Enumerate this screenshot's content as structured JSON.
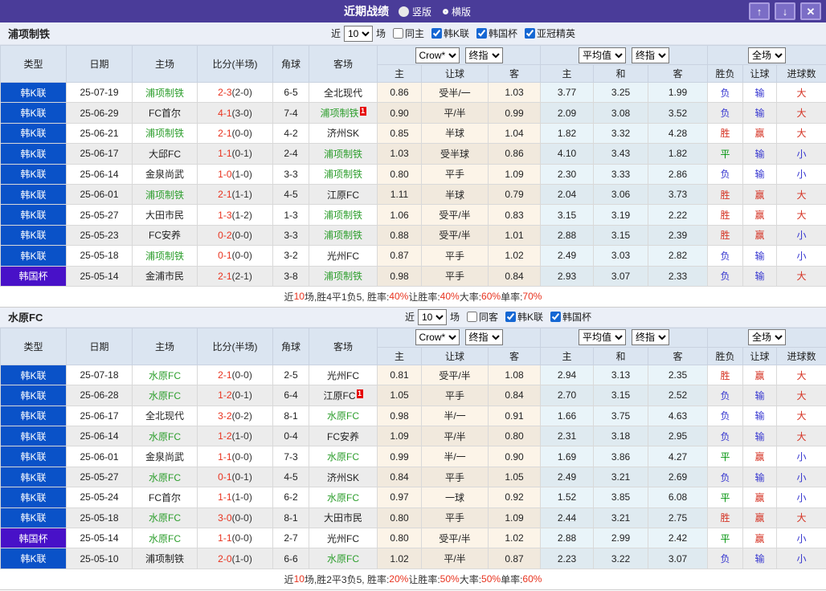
{
  "colors": {
    "titlebar_purple": "#4a3c99",
    "league_blue": "#0a52c8",
    "cup_purple": "#4811c8",
    "focus_team_green": "#2d9e2d",
    "score_red": "#e8321e",
    "result_red": "#d53223",
    "result_blue": "#3535cf",
    "result_green": "#00930c"
  },
  "titlebar": {
    "title": "近期战绩",
    "radios": [
      {
        "label": "竖版",
        "selected": true
      },
      {
        "label": "横版",
        "selected": false
      }
    ],
    "up_button": "↑",
    "down_button": "↓",
    "close_button": "✕"
  },
  "table_header": {
    "type": "类型",
    "date": "日期",
    "home": "主场",
    "score": "比分(半场)",
    "corner": "角球",
    "away": "客场",
    "crow_select": "Crow*",
    "final_select": "终指",
    "avg_select": "平均值",
    "final_select2": "终指",
    "full_select": "全场",
    "sub": {
      "h_home": "主",
      "h_line": "让球",
      "h_away": "客",
      "a_home": "主",
      "a_draw": "和",
      "a_away": "客",
      "r_wl": "胜负",
      "r_let": "让球",
      "r_goals": "进球数"
    }
  },
  "sections": [
    {
      "team": "浦项制铁",
      "filter": {
        "near_label": "近",
        "count": "10",
        "games_label": "场",
        "same_label": "同主",
        "same_checked": false,
        "leagues": [
          {
            "label": "韩K联",
            "checked": true
          },
          {
            "label": "韩国杯",
            "checked": true
          },
          {
            "label": "亚冠精英",
            "checked": true
          }
        ]
      },
      "rows": [
        {
          "type": "韩K联",
          "type_color": "blue",
          "date": "25-07-19",
          "home": "浦项制铁",
          "home_focus": true,
          "home_redcard": "",
          "score": "2-3",
          "half": "(2-0)",
          "corner": "6-5",
          "away": "全北现代",
          "away_focus": false,
          "away_redcard": "",
          "odds_home": "0.86",
          "line": "受半/一",
          "odds_away": "1.03",
          "avg_home": "3.77",
          "avg_draw": "3.25",
          "avg_away": "1.99",
          "res_wl": "负",
          "res_wl_c": "blue",
          "res_let": "输",
          "res_let_c": "blue",
          "res_goal": "大",
          "res_goal_c": "red"
        },
        {
          "type": "韩K联",
          "type_color": "blue",
          "date": "25-06-29",
          "home": "FC首尔",
          "home_focus": false,
          "home_redcard": "",
          "score": "4-1",
          "half": "(3-0)",
          "corner": "7-4",
          "away": "浦项制铁",
          "away_focus": true,
          "away_redcard": "1",
          "odds_home": "0.90",
          "line": "平/半",
          "odds_away": "0.99",
          "avg_home": "2.09",
          "avg_draw": "3.08",
          "avg_away": "3.52",
          "res_wl": "负",
          "res_wl_c": "blue",
          "res_let": "输",
          "res_let_c": "blue",
          "res_goal": "大",
          "res_goal_c": "red"
        },
        {
          "type": "韩K联",
          "type_color": "blue",
          "date": "25-06-21",
          "home": "浦项制铁",
          "home_focus": true,
          "home_redcard": "",
          "score": "2-1",
          "half": "(0-0)",
          "corner": "4-2",
          "away": "济州SK",
          "away_focus": false,
          "away_redcard": "",
          "odds_home": "0.85",
          "line": "半球",
          "odds_away": "1.04",
          "avg_home": "1.82",
          "avg_draw": "3.32",
          "avg_away": "4.28",
          "res_wl": "胜",
          "res_wl_c": "red",
          "res_let": "赢",
          "res_let_c": "red",
          "res_goal": "大",
          "res_goal_c": "red"
        },
        {
          "type": "韩K联",
          "type_color": "blue",
          "date": "25-06-17",
          "home": "大邱FC",
          "home_focus": false,
          "home_redcard": "",
          "score": "1-1",
          "half": "(0-1)",
          "corner": "2-4",
          "away": "浦项制铁",
          "away_focus": true,
          "away_redcard": "",
          "odds_home": "1.03",
          "line": "受半球",
          "odds_away": "0.86",
          "avg_home": "4.10",
          "avg_draw": "3.43",
          "avg_away": "1.82",
          "res_wl": "平",
          "res_wl_c": "green",
          "res_let": "输",
          "res_let_c": "blue",
          "res_goal": "小",
          "res_goal_c": "blue"
        },
        {
          "type": "韩K联",
          "type_color": "blue",
          "date": "25-06-14",
          "home": "金泉尚武",
          "home_focus": false,
          "home_redcard": "",
          "score": "1-0",
          "half": "(1-0)",
          "corner": "3-3",
          "away": "浦项制铁",
          "away_focus": true,
          "away_redcard": "",
          "odds_home": "0.80",
          "line": "平手",
          "odds_away": "1.09",
          "avg_home": "2.30",
          "avg_draw": "3.33",
          "avg_away": "2.86",
          "res_wl": "负",
          "res_wl_c": "blue",
          "res_let": "输",
          "res_let_c": "blue",
          "res_goal": "小",
          "res_goal_c": "blue"
        },
        {
          "type": "韩K联",
          "type_color": "blue",
          "date": "25-06-01",
          "home": "浦项制铁",
          "home_focus": true,
          "home_redcard": "",
          "score": "2-1",
          "half": "(1-1)",
          "corner": "4-5",
          "away": "江原FC",
          "away_focus": false,
          "away_redcard": "",
          "odds_home": "1.11",
          "line": "半球",
          "odds_away": "0.79",
          "avg_home": "2.04",
          "avg_draw": "3.06",
          "avg_away": "3.73",
          "res_wl": "胜",
          "res_wl_c": "red",
          "res_let": "赢",
          "res_let_c": "red",
          "res_goal": "大",
          "res_goal_c": "red"
        },
        {
          "type": "韩K联",
          "type_color": "blue",
          "date": "25-05-27",
          "home": "大田市民",
          "home_focus": false,
          "home_redcard": "",
          "score": "1-3",
          "half": "(1-2)",
          "corner": "1-3",
          "away": "浦项制铁",
          "away_focus": true,
          "away_redcard": "",
          "odds_home": "1.06",
          "line": "受平/半",
          "odds_away": "0.83",
          "avg_home": "3.15",
          "avg_draw": "3.19",
          "avg_away": "2.22",
          "res_wl": "胜",
          "res_wl_c": "red",
          "res_let": "赢",
          "res_let_c": "red",
          "res_goal": "大",
          "res_goal_c": "red"
        },
        {
          "type": "韩K联",
          "type_color": "blue",
          "date": "25-05-23",
          "home": "FC安养",
          "home_focus": false,
          "home_redcard": "",
          "score": "0-2",
          "half": "(0-0)",
          "corner": "3-3",
          "away": "浦项制铁",
          "away_focus": true,
          "away_redcard": "",
          "odds_home": "0.88",
          "line": "受平/半",
          "odds_away": "1.01",
          "avg_home": "2.88",
          "avg_draw": "3.15",
          "avg_away": "2.39",
          "res_wl": "胜",
          "res_wl_c": "red",
          "res_let": "赢",
          "res_let_c": "red",
          "res_goal": "小",
          "res_goal_c": "blue"
        },
        {
          "type": "韩K联",
          "type_color": "blue",
          "date": "25-05-18",
          "home": "浦项制铁",
          "home_focus": true,
          "home_redcard": "",
          "score": "0-1",
          "half": "(0-0)",
          "corner": "3-2",
          "away": "光州FC",
          "away_focus": false,
          "away_redcard": "",
          "odds_home": "0.87",
          "line": "平手",
          "odds_away": "1.02",
          "avg_home": "2.49",
          "avg_draw": "3.03",
          "avg_away": "2.82",
          "res_wl": "负",
          "res_wl_c": "blue",
          "res_let": "输",
          "res_let_c": "blue",
          "res_goal": "小",
          "res_goal_c": "blue"
        },
        {
          "type": "韩国杯",
          "type_color": "purple",
          "date": "25-05-14",
          "home": "金浦市民",
          "home_focus": false,
          "home_redcard": "",
          "score": "2-1",
          "half": "(2-1)",
          "corner": "3-8",
          "away": "浦项制铁",
          "away_focus": true,
          "away_redcard": "",
          "odds_home": "0.98",
          "line": "平手",
          "odds_away": "0.84",
          "avg_home": "2.93",
          "avg_draw": "3.07",
          "avg_away": "2.33",
          "res_wl": "负",
          "res_wl_c": "blue",
          "res_let": "输",
          "res_let_c": "blue",
          "res_goal": "大",
          "res_goal_c": "red"
        }
      ],
      "summary": [
        {
          "text": "近",
          "red": false
        },
        {
          "text": "10",
          "red": true
        },
        {
          "text": "场,胜4平1负5, 胜率:",
          "red": false
        },
        {
          "text": "40%",
          "red": true
        },
        {
          "text": " 让胜率:",
          "red": false
        },
        {
          "text": "40%",
          "red": true
        },
        {
          "text": " 大率:",
          "red": false
        },
        {
          "text": "60%",
          "red": true
        },
        {
          "text": " 单率:",
          "red": false
        },
        {
          "text": "70%",
          "red": true
        }
      ]
    },
    {
      "team": "水原FC",
      "filter": {
        "near_label": "近",
        "count": "10",
        "games_label": "场",
        "same_label": "同客",
        "same_checked": false,
        "leagues": [
          {
            "label": "韩K联",
            "checked": true
          },
          {
            "label": "韩国杯",
            "checked": true
          }
        ]
      },
      "rows": [
        {
          "type": "韩K联",
          "type_color": "blue",
          "date": "25-07-18",
          "home": "水原FC",
          "home_focus": true,
          "home_redcard": "",
          "score": "2-1",
          "half": "(0-0)",
          "corner": "2-5",
          "away": "光州FC",
          "away_focus": false,
          "away_redcard": "",
          "odds_home": "0.81",
          "line": "受平/半",
          "odds_away": "1.08",
          "avg_home": "2.94",
          "avg_draw": "3.13",
          "avg_away": "2.35",
          "res_wl": "胜",
          "res_wl_c": "red",
          "res_let": "赢",
          "res_let_c": "red",
          "res_goal": "大",
          "res_goal_c": "red"
        },
        {
          "type": "韩K联",
          "type_color": "blue",
          "date": "25-06-28",
          "home": "水原FC",
          "home_focus": true,
          "home_redcard": "",
          "score": "1-2",
          "half": "(0-1)",
          "corner": "6-4",
          "away": "江原FC",
          "away_focus": false,
          "away_redcard": "1",
          "odds_home": "1.05",
          "line": "平手",
          "odds_away": "0.84",
          "avg_home": "2.70",
          "avg_draw": "3.15",
          "avg_away": "2.52",
          "res_wl": "负",
          "res_wl_c": "blue",
          "res_let": "输",
          "res_let_c": "blue",
          "res_goal": "大",
          "res_goal_c": "red"
        },
        {
          "type": "韩K联",
          "type_color": "blue",
          "date": "25-06-17",
          "home": "全北现代",
          "home_focus": false,
          "home_redcard": "",
          "score": "3-2",
          "half": "(0-2)",
          "corner": "8-1",
          "away": "水原FC",
          "away_focus": true,
          "away_redcard": "",
          "odds_home": "0.98",
          "line": "半/一",
          "odds_away": "0.91",
          "avg_home": "1.66",
          "avg_draw": "3.75",
          "avg_away": "4.63",
          "res_wl": "负",
          "res_wl_c": "blue",
          "res_let": "输",
          "res_let_c": "blue",
          "res_goal": "大",
          "res_goal_c": "red"
        },
        {
          "type": "韩K联",
          "type_color": "blue",
          "date": "25-06-14",
          "home": "水原FC",
          "home_focus": true,
          "home_redcard": "",
          "score": "1-2",
          "half": "(1-0)",
          "corner": "0-4",
          "away": "FC安养",
          "away_focus": false,
          "away_redcard": "",
          "odds_home": "1.09",
          "line": "平/半",
          "odds_away": "0.80",
          "avg_home": "2.31",
          "avg_draw": "3.18",
          "avg_away": "2.95",
          "res_wl": "负",
          "res_wl_c": "blue",
          "res_let": "输",
          "res_let_c": "blue",
          "res_goal": "大",
          "res_goal_c": "red"
        },
        {
          "type": "韩K联",
          "type_color": "blue",
          "date": "25-06-01",
          "home": "金泉尚武",
          "home_focus": false,
          "home_redcard": "",
          "score": "1-1",
          "half": "(0-0)",
          "corner": "7-3",
          "away": "水原FC",
          "away_focus": true,
          "away_redcard": "",
          "odds_home": "0.99",
          "line": "半/一",
          "odds_away": "0.90",
          "avg_home": "1.69",
          "avg_draw": "3.86",
          "avg_away": "4.27",
          "res_wl": "平",
          "res_wl_c": "green",
          "res_let": "赢",
          "res_let_c": "red",
          "res_goal": "小",
          "res_goal_c": "blue"
        },
        {
          "type": "韩K联",
          "type_color": "blue",
          "date": "25-05-27",
          "home": "水原FC",
          "home_focus": true,
          "home_redcard": "",
          "score": "0-1",
          "half": "(0-1)",
          "corner": "4-5",
          "away": "济州SK",
          "away_focus": false,
          "away_redcard": "",
          "odds_home": "0.84",
          "line": "平手",
          "odds_away": "1.05",
          "avg_home": "2.49",
          "avg_draw": "3.21",
          "avg_away": "2.69",
          "res_wl": "负",
          "res_wl_c": "blue",
          "res_let": "输",
          "res_let_c": "blue",
          "res_goal": "小",
          "res_goal_c": "blue"
        },
        {
          "type": "韩K联",
          "type_color": "blue",
          "date": "25-05-24",
          "home": "FC首尔",
          "home_focus": false,
          "home_redcard": "",
          "score": "1-1",
          "half": "(1-0)",
          "corner": "6-2",
          "away": "水原FC",
          "away_focus": true,
          "away_redcard": "",
          "odds_home": "0.97",
          "line": "一球",
          "odds_away": "0.92",
          "avg_home": "1.52",
          "avg_draw": "3.85",
          "avg_away": "6.08",
          "res_wl": "平",
          "res_wl_c": "green",
          "res_let": "赢",
          "res_let_c": "red",
          "res_goal": "小",
          "res_goal_c": "blue"
        },
        {
          "type": "韩K联",
          "type_color": "blue",
          "date": "25-05-18",
          "home": "水原FC",
          "home_focus": true,
          "home_redcard": "",
          "score": "3-0",
          "half": "(0-0)",
          "corner": "8-1",
          "away": "大田市民",
          "away_focus": false,
          "away_redcard": "",
          "odds_home": "0.80",
          "line": "平手",
          "odds_away": "1.09",
          "avg_home": "2.44",
          "avg_draw": "3.21",
          "avg_away": "2.75",
          "res_wl": "胜",
          "res_wl_c": "red",
          "res_let": "赢",
          "res_let_c": "red",
          "res_goal": "大",
          "res_goal_c": "red"
        },
        {
          "type": "韩国杯",
          "type_color": "purple",
          "date": "25-05-14",
          "home": "水原FC",
          "home_focus": true,
          "home_redcard": "",
          "score": "1-1",
          "half": "(0-0)",
          "corner": "2-7",
          "away": "光州FC",
          "away_focus": false,
          "away_redcard": "",
          "odds_home": "0.80",
          "line": "受平/半",
          "odds_away": "1.02",
          "avg_home": "2.88",
          "avg_draw": "2.99",
          "avg_away": "2.42",
          "res_wl": "平",
          "res_wl_c": "green",
          "res_let": "赢",
          "res_let_c": "red",
          "res_goal": "小",
          "res_goal_c": "blue"
        },
        {
          "type": "韩K联",
          "type_color": "blue",
          "date": "25-05-10",
          "home": "浦项制铁",
          "home_focus": false,
          "home_redcard": "",
          "score": "2-0",
          "half": "(1-0)",
          "corner": "6-6",
          "away": "水原FC",
          "away_focus": true,
          "away_redcard": "",
          "odds_home": "1.02",
          "line": "平/半",
          "odds_away": "0.87",
          "avg_home": "2.23",
          "avg_draw": "3.22",
          "avg_away": "3.07",
          "res_wl": "负",
          "res_wl_c": "blue",
          "res_let": "输",
          "res_let_c": "blue",
          "res_goal": "小",
          "res_goal_c": "blue"
        }
      ],
      "summary": [
        {
          "text": "近",
          "red": false
        },
        {
          "text": "10",
          "red": true
        },
        {
          "text": "场,胜2平3负5, 胜率:",
          "red": false
        },
        {
          "text": "20%",
          "red": true
        },
        {
          "text": " 让胜率:",
          "red": false
        },
        {
          "text": "50%",
          "red": true
        },
        {
          "text": " 大率:",
          "red": false
        },
        {
          "text": "50%",
          "red": true
        },
        {
          "text": " 单率:",
          "red": false
        },
        {
          "text": "60%",
          "red": true
        }
      ]
    }
  ]
}
